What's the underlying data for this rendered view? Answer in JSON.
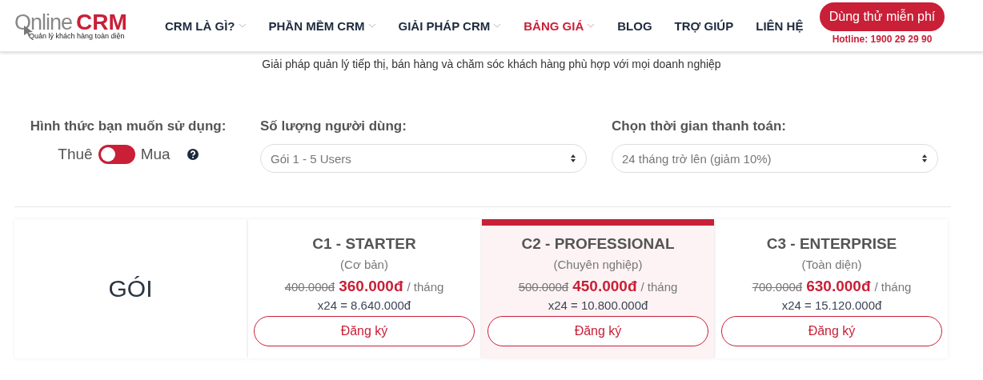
{
  "header": {
    "logo": {
      "word": "Online",
      "brand": "CRM",
      "tagline": "Quản lý khách hàng toàn diện"
    },
    "nav": [
      {
        "label": "CRM LÀ GÌ?",
        "has_dropdown": true,
        "selected": false
      },
      {
        "label": "PHẦN MỀM CRM",
        "has_dropdown": true,
        "selected": false
      },
      {
        "label": "GIẢI PHÁP CRM",
        "has_dropdown": true,
        "selected": false
      },
      {
        "label": "BẢNG GIÁ",
        "has_dropdown": true,
        "selected": true
      },
      {
        "label": "BLOG",
        "has_dropdown": false,
        "selected": false
      },
      {
        "label": "TRỢ GIÚP",
        "has_dropdown": false,
        "selected": false
      },
      {
        "label": "LIÊN HỆ",
        "has_dropdown": false,
        "selected": false
      }
    ],
    "cta": {
      "label": "Dùng thử miễn phí",
      "hotline": "Hotline: 1900 29 29 90"
    }
  },
  "subtitle": "Giải pháp quản lý tiếp thị, bán hàng và chăm sóc khách hàng phù hợp với mọi doanh nghiệp",
  "filters": {
    "usage": {
      "label": "Hình thức bạn muốn sử dụng:",
      "left": "Thuê",
      "right": "Mua",
      "on": false
    },
    "users": {
      "label": "Số lượng người dùng:",
      "value": "Gói 1 - 5 Users"
    },
    "period": {
      "label": "Chọn thời gian thanh toán:",
      "value": "24 tháng trở lên (giảm 10%)"
    }
  },
  "pricing": {
    "heading": "GÓI",
    "plans": [
      {
        "name": "C1 - STARTER",
        "subtitle": "(Cơ bản)",
        "old_price": "400.000đ",
        "price": "360.000đ",
        "unit": "/ tháng",
        "total": "x24 = 8.640.000đ",
        "button": "Đăng ký",
        "featured": false
      },
      {
        "name": "C2 - PROFESSIONAL",
        "subtitle": "(Chuyên nghiệp)",
        "old_price": "500.000đ",
        "price": "450.000đ",
        "unit": "/ tháng",
        "total": "x24 = 10.800.000đ",
        "button": "Đăng ký",
        "featured": true
      },
      {
        "name": "C3 - ENTERPRISE",
        "subtitle": "(Toàn diện)",
        "old_price": "700.000đ",
        "price": "630.000đ",
        "unit": "/ tháng",
        "total": "x24 = 15.120.000đ",
        "button": "Đăng ký",
        "featured": false
      }
    ]
  }
}
